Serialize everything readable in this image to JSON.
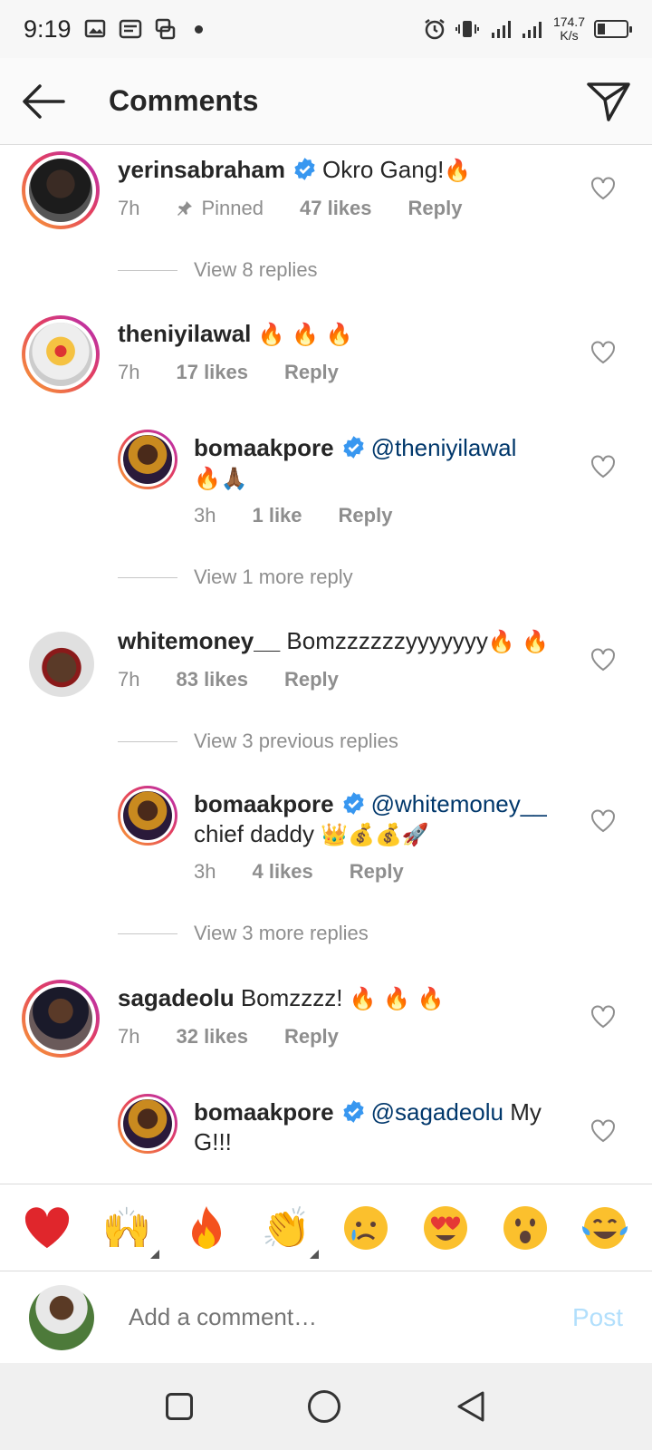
{
  "status_bar": {
    "time": "9:19",
    "speed_value": "174.7",
    "speed_unit": "K/s"
  },
  "header": {
    "title": "Comments",
    "back_icon": "arrow-left-icon",
    "share_icon": "paper-plane-icon"
  },
  "comments": [
    {
      "username": "yerinsabraham",
      "verified": true,
      "text": "Okro Gang!",
      "emojis": "🔥",
      "time": "7h",
      "pinned_label": "Pinned",
      "likes": "47 likes",
      "reply_label": "Reply",
      "view_replies": "View 8 replies"
    },
    {
      "username": "theniyilawal",
      "verified": false,
      "text": "",
      "emojis": "🔥 🔥 🔥",
      "time": "7h",
      "likes": "17 likes",
      "reply_label": "Reply",
      "reply": {
        "username": "bomaakpore",
        "verified": true,
        "mention": "@theniyilawal",
        "emojis": "🔥🙏🏾",
        "time": "3h",
        "likes": "1 like",
        "reply_label": "Reply"
      },
      "view_replies": "View 1 more reply"
    },
    {
      "username": "whitemoney__",
      "verified": false,
      "text": "Bomzzzzzzyyyyyyy",
      "emojis": "🔥 🔥",
      "time": "7h",
      "likes": "83 likes",
      "reply_label": "Reply",
      "view_previous": "View 3 previous replies",
      "reply": {
        "username": "bomaakpore",
        "verified": true,
        "mention": "@whitemoney__",
        "text": "chief daddy",
        "emojis": "👑💰💰🚀",
        "time": "3h",
        "likes": "4 likes",
        "reply_label": "Reply"
      },
      "view_replies": "View 3 more replies"
    },
    {
      "username": "sagadeolu",
      "verified": false,
      "text": "Bomzzzz!",
      "emojis": "🔥 🔥 🔥",
      "time": "7h",
      "likes": "32 likes",
      "reply_label": "Reply",
      "reply": {
        "username": "bomaakpore",
        "verified": true,
        "mention": "@sagadeolu",
        "text": "My G!!!"
      }
    }
  ],
  "reactions": [
    "❤️",
    "🙌",
    "🔥",
    "👏",
    "😢",
    "😍",
    "😮",
    "😂"
  ],
  "add_comment": {
    "placeholder": "Add a comment…",
    "post_label": "Post"
  },
  "colors": {
    "mention": "#00376b",
    "meta": "#8e8e8e",
    "verified": "#3897f0",
    "post_disabled": "#b2dffc"
  }
}
